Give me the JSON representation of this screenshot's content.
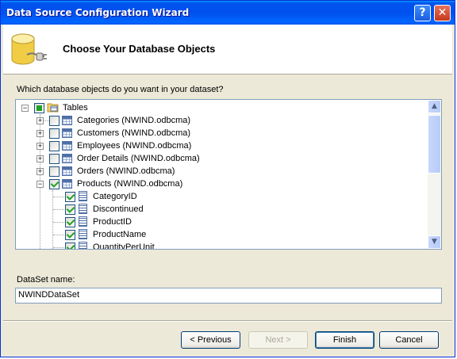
{
  "window": {
    "title": "Data Source Configuration Wizard",
    "help_glyph": "?",
    "close_glyph": "✕"
  },
  "header": {
    "title": "Choose Your Database Objects",
    "icon": "database-plug-icon"
  },
  "prompt": "Which database objects do you want in your dataset?",
  "tree": {
    "root": {
      "label": "Tables",
      "expander": "−",
      "state": "partial"
    },
    "tables": [
      {
        "label": "Categories (NWIND.odbcma)",
        "expander": "+",
        "checked": false
      },
      {
        "label": "Customers (NWIND.odbcma)",
        "expander": "+",
        "checked": false
      },
      {
        "label": "Employees (NWIND.odbcma)",
        "expander": "+",
        "checked": false
      },
      {
        "label": "Order Details (NWIND.odbcma)",
        "expander": "+",
        "checked": false
      },
      {
        "label": "Orders (NWIND.odbcma)",
        "expander": "+",
        "checked": false
      },
      {
        "label": "Products (NWIND.odbcma)",
        "expander": "−",
        "checked": true
      }
    ],
    "columns": [
      {
        "label": "CategoryID",
        "checked": true
      },
      {
        "label": "Discontinued",
        "checked": true
      },
      {
        "label": "ProductID",
        "checked": true
      },
      {
        "label": "ProductName",
        "checked": true
      },
      {
        "label": "QuantityPerUnit",
        "checked": true
      }
    ]
  },
  "scroll": {
    "up": "▲",
    "down": "▼"
  },
  "dataset": {
    "label": "DataSet name:",
    "value": "NWINDDataSet"
  },
  "buttons": {
    "previous": "< Previous",
    "next": "Next >",
    "finish": "Finish",
    "cancel": "Cancel"
  }
}
